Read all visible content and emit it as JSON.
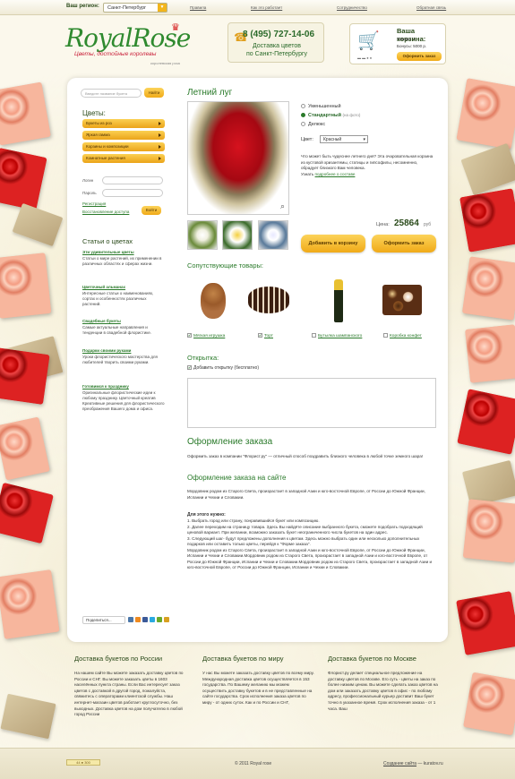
{
  "topbar": {
    "region_label": "Ваш регион:",
    "region_value": "Санкт-Петербург",
    "links": [
      "Правила",
      "Как это работает",
      "Сотрудничество",
      "Обратная связь"
    ]
  },
  "header": {
    "logo_name": "RoyalRose",
    "logo_tagline": "Цветы, достойные королевы",
    "logo_sub": "королевская роза",
    "phone": "8 (495) 727-14-06",
    "phone_text1": "Доставка цветов",
    "phone_text2": "по Санкт-Петербургу",
    "cart_title": "Ваша корзина:",
    "cart_goods": "Товары: 1",
    "cart_bonus": "Бонусы: 5000 р.",
    "checkout_label": "Оформить заказ"
  },
  "sidebar": {
    "search_placeholder": "Введите название букета",
    "search_button": "Найти",
    "flowers_title": "Цветы:",
    "categories": [
      "Букеты из роз",
      "Яркая гамма",
      "Корзины и композиции",
      "Комнатные растения"
    ],
    "login_label": "Логин",
    "password_label": "Пароль",
    "register_link": "Регистрация",
    "restore_link": "Восстановление доступа",
    "login_button": "Войти",
    "articles_title": "Статьи о цветах",
    "articles": [
      {
        "title": "Эти удивительные цветы",
        "text": "Статьи о мире растений, их применении в различных областях и сферах жизни."
      },
      {
        "title": "Цветочный альманах",
        "text": "Интересные статьи о наименованиях, сортах и особенностях различных растений."
      },
      {
        "title": "Свадебные букеты",
        "text": "Самые актуальные направления и тенденции в свадебной флористике."
      },
      {
        "title": "Подарки своими руками",
        "text": "Уроки флористического мастерства для любителей творить своими руками."
      },
      {
        "title": "Готовимся к празднику",
        "text": "Оригинальные флористические идеи к любому празднику. Цветочный креатив Креативные решения для флористического преображения Вашего дома и офиса."
      }
    ],
    "share_label": "Поделиться..."
  },
  "product": {
    "title": "Летний луг",
    "options": [
      "Уменьшенный",
      "Стандартный",
      "Делюкс"
    ],
    "selected_hint": "(на фото)",
    "color_label": "Цвет:",
    "color_value": "Красный",
    "description": "Что может быть чудеснее летнего дня? Эта очаровательная корзина из кустовой хризантемы, статицы и гипсофилы, несомненно, обрадует близкого Вам человека.",
    "learn_more": "Узнать",
    "learn_more_link": "подробнее о составе",
    "price_label": "Цена:",
    "price": "25864",
    "currency": "руб",
    "add_to_cart": "Добавить в корзину",
    "order_button": "Оформить заказ"
  },
  "related": {
    "title": "Сопутствующие товары:",
    "items": [
      {
        "name": "Мягкая игрушка",
        "checked": true
      },
      {
        "name": "Торт",
        "checked": true
      },
      {
        "name": "Бутылка шампанского",
        "checked": false
      },
      {
        "name": "Коробка конфет",
        "checked": false
      }
    ]
  },
  "card": {
    "title": "Открытка:",
    "checkbox_label": "Добавить открытку (бесплатно)"
  },
  "order": {
    "title": "Оформление заказа",
    "intro": "Оформить заказ в компании \"Флорист.ру\" — отличный способ поздравить близкого человека в любой точке земного шара!",
    "subtitle": "Оформление заказа на сайте",
    "p1": "Мордовник родом из Старого Света, произрастает в западной Азии и юго-восточной Европе, от России до Южной Франции, Испании и Чехии и Словакии.",
    "need": "Для этого нужно:",
    "p2": "1. Выбрать город или страну, понравившийся букет или композицию.\n2. Далее переходим на страницу товара. Здесь Вы найдёте описание выбранного букета, сможете подобрать подходящий ценовой вариант. При желании, возможно заказать букет неограниченного числа букетов на один адрес.\n3. Следующий шаг- будут предложены дополнения к цветам. Здесь можно выбрать один или несколько дополнительных подарков или оставить только цветы, перейдя к \"Форме заказа\".\nМордовник родом из Старого Света, произрастает в западной Азии и юго-восточной Европе, от России до Южной Франции, Испании и Чехии и Словакии.Мордовник родом из Старого Света, произрастает в западной Азии и юго-восточной Европе, от России до Южной Франции, Испании и Чехии и Словакии.Мордовник родом из Старого Света, произрастает в западной Азии и юго-восточной Европе, от России до Южной Франции, Испании и Чехии и Словакии."
  },
  "footer_cols": [
    {
      "title": "Доставка букетов по России",
      "text": "На нашем сайте Вы можете заказать доставку цветов по России и СНГ. Вы можете заказать цветы в 1603 населённых пункта страны. Если Вас интересует заказ цветов с доставкой в другой город, пожалуйста, свяжитесь с операторами клиентской службы. Наш интернет-магазин цветов работает круглосуточно, без выходных. Доставка цветов на дом получателю в любой город России"
    },
    {
      "title": "Доставка букетов по миру",
      "text": "У нас Вы можете заказать доставку цветов по всему миру. Международная доставка цветов осуществляется в 153 государства. По Вашему желанию мы можем осуществить доставку букетов и в не представленные на сайте государства. Срок исполнения заказа цветов по миру - от одних суток. Как и по России и СНГ,"
    },
    {
      "title": "Доставка букетов по Москве",
      "text": "Флорист.ру делает специальное предложение на доставку цветов по Москве. Его суть - цветы на заказ по более низким ценам. Вы можете сделать заказ цветов на дом или заказать доставку цветов в офис - по любому адресу, профессиональный курьер доставит Ваш букет точно в указанное время. Срок исполнения заказа - от 1 часа. Ваш"
    }
  ],
  "bottom": {
    "copyright": "© 2011 Royal rose",
    "made_by": "Создание сайта",
    "made_by_rest": " — kuratov.ru",
    "counter": "44 ● 300"
  },
  "colors": {
    "green": "#2a7a2a",
    "orange": "#f0aa18",
    "accent_red": "#c9203a"
  }
}
